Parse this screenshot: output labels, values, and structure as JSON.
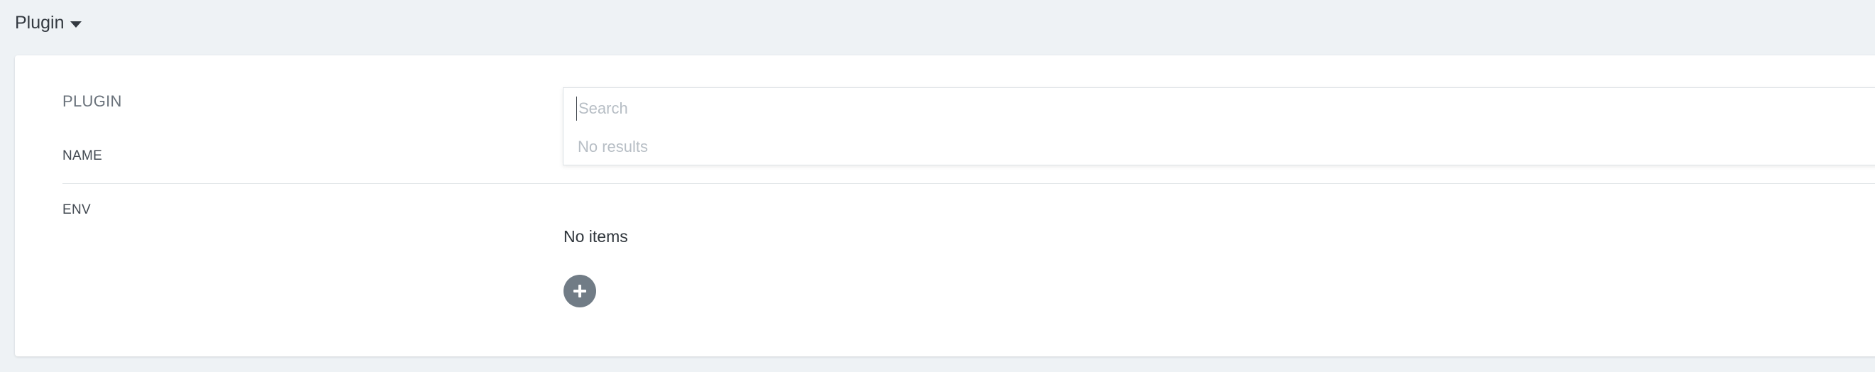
{
  "header": {
    "title": "Plugin",
    "caret_icon": "caret-down-icon"
  },
  "form": {
    "plugin_label": "PLUGIN",
    "name_label": "NAME",
    "env_label": "ENV"
  },
  "plugin_select": {
    "search_placeholder": "Search",
    "search_value": "",
    "no_results_text": "No results",
    "open": true
  },
  "env_list": {
    "empty_text": "No items",
    "add_icon": "plus-icon"
  },
  "colors": {
    "background": "#eef2f5",
    "card": "#ffffff",
    "add_button": "#717c86",
    "placeholder": "#b7bec5"
  }
}
